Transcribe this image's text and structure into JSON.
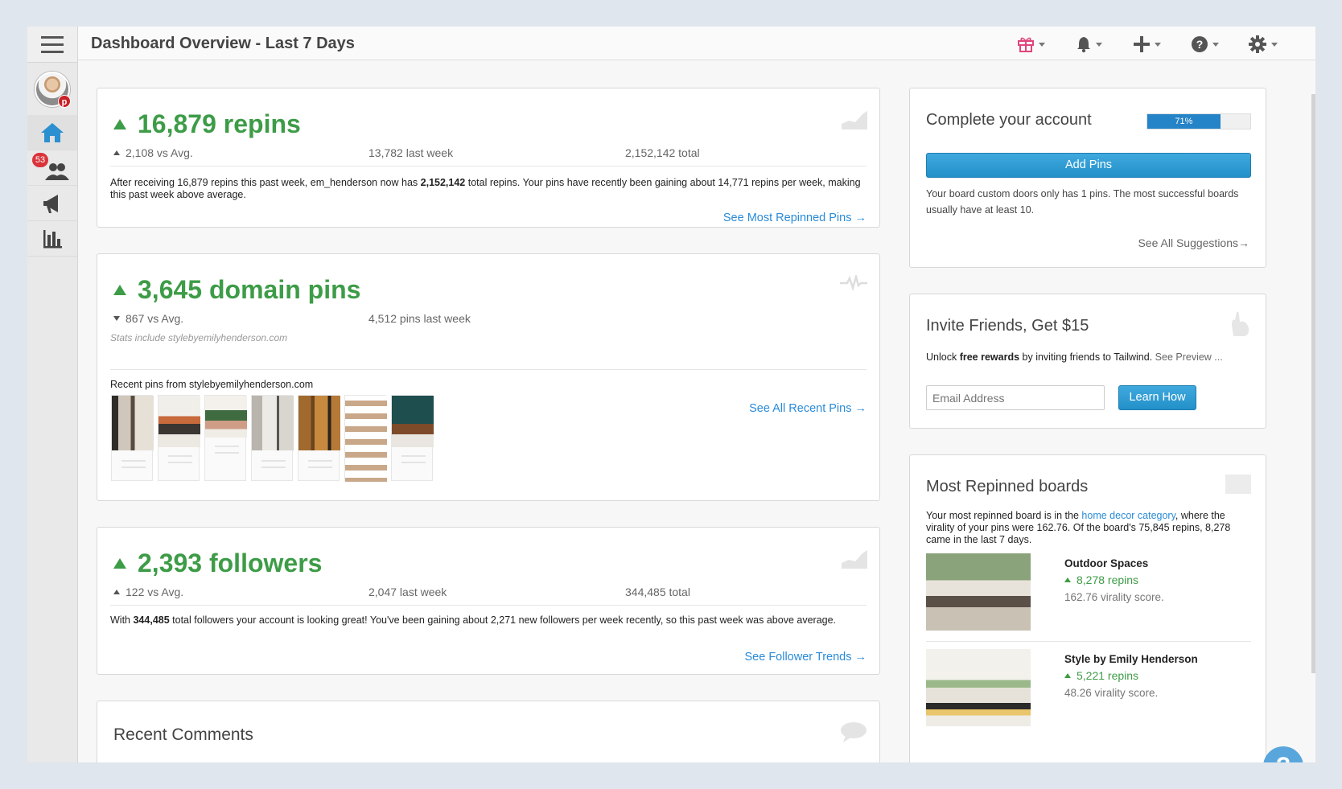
{
  "header": {
    "title": "Dashboard Overview - Last 7 Days",
    "icons": [
      "gift-icon",
      "bell-icon",
      "plus-icon",
      "help-icon",
      "gear-icon"
    ]
  },
  "sidebar": {
    "badge_count": "53",
    "pin_badge": "p",
    "items": [
      "home-icon",
      "users-icon",
      "megaphone-icon",
      "bar-chart-icon"
    ]
  },
  "repins": {
    "headline": "16,879 repins",
    "vs_avg": "2,108 vs Avg.",
    "last_week": "13,782 last week",
    "total": "2,152,142 total",
    "desc_pre": "After receiving 16,879 repins this past week, em_henderson now has ",
    "desc_bold": "2,152,142",
    "desc_post": " total repins. Your pins have recently been gaining about 14,771 repins per week, making this past week above average.",
    "link": "See Most Repinned Pins →"
  },
  "domain_pins": {
    "headline": "3,645 domain pins",
    "vs_avg": "867 vs Avg.",
    "last_week": "4,512 pins last week",
    "stats_note": "Stats include stylebyemilyhenderson.com",
    "recent_label": "Recent pins from stylebyemilyhenderson.com",
    "link": "See All Recent Pins →"
  },
  "followers": {
    "headline": "2,393 followers",
    "vs_avg": "122 vs Avg.",
    "last_week": "2,047 last week",
    "total": "344,485 total",
    "desc_pre": "With ",
    "desc_bold": "344,485",
    "desc_post": " total followers your account is looking great! You've been gaining about 2,271 new followers per week recently, so this past week was above average.",
    "link": "See Follower Trends →"
  },
  "comments": {
    "title": "Recent Comments"
  },
  "complete_account": {
    "title": "Complete your account",
    "progress": 71,
    "progress_label": "71%",
    "button": "Add Pins",
    "text": "Your board custom doors only has 1 pins. The most successful boards usually have at least 10.",
    "link": "See All Suggestions→"
  },
  "invite": {
    "title": "Invite Friends, Get $15",
    "text_pre": "Unlock ",
    "text_bold": "free rewards",
    "text_mid": " by inviting friends to Tailwind. ",
    "text_link": "See Preview ...",
    "email_placeholder": "Email Address",
    "button": "Learn How"
  },
  "most_repinned": {
    "title": "Most Repinned boards",
    "text_pre": "Your most repinned board is in the ",
    "text_link": "home decor category",
    "text_post": ", where the virality of your pins were 162.76. Of the board's 75,845 repins, 8,278 came in the last 7 days.",
    "boards": [
      {
        "name": "Outdoor Spaces",
        "repins": "8,278 repins",
        "score": "162.76 virality score."
      },
      {
        "name": "Style by Emily Henderson",
        "repins": "5,221 repins",
        "score": "48.26 virality score."
      }
    ]
  },
  "help_bubble": "?"
}
